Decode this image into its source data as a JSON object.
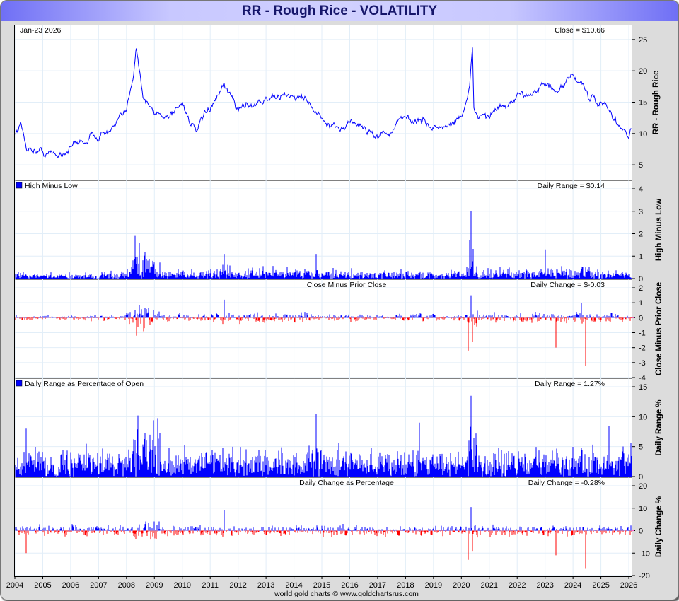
{
  "title": "RR  -  Rough Rice - VOLATILITY",
  "footer": "world gold charts © www.goldchartsrus.com",
  "colors": {
    "up": "#0000ff",
    "down": "#ff0000",
    "grid": "#e2eef8",
    "zero": "#ff66cc"
  },
  "chart_data": [
    {
      "type": "line",
      "title": "Rough Rice",
      "date_label": "Jan-23  2026",
      "value_label": "Close = $10.66",
      "ylabel": "RR  -  Rough Rice",
      "ylim": [
        4,
        26
      ],
      "yticks": [
        5,
        10,
        15,
        20,
        25
      ],
      "x": [
        2004.0,
        2004.2,
        2004.4,
        2005.0,
        2005.5,
        2006.0,
        2007.0,
        2007.5,
        2008.0,
        2008.25,
        2008.35,
        2008.6,
        2009.0,
        2009.5,
        2010.0,
        2010.5,
        2011.0,
        2011.5,
        2012.0,
        2012.5,
        2013.0,
        2014.0,
        2014.5,
        2015.0,
        2015.5,
        2016.0,
        2016.5,
        2017.0,
        2017.5,
        2018.0,
        2018.5,
        2019.0,
        2019.5,
        2020.0,
        2020.3,
        2020.4,
        2020.45,
        2021.0,
        2021.5,
        2022.0,
        2022.5,
        2023.0,
        2023.5,
        2024.0,
        2024.4,
        2024.6,
        2025.0,
        2025.5,
        2026.0,
        2026.06
      ],
      "y": [
        10,
        11.5,
        8,
        7,
        6.5,
        8,
        10,
        10.5,
        13,
        20,
        24.5,
        16,
        13,
        13,
        15,
        10,
        14,
        17,
        14,
        15,
        15.5,
        16,
        15.5,
        12,
        10,
        12,
        11,
        9.8,
        10.5,
        12.5,
        12,
        11,
        11,
        13,
        17,
        23,
        13,
        13,
        14,
        15,
        17,
        18,
        16,
        19,
        18,
        15,
        15,
        12,
        9.5,
        10.66
      ]
    },
    {
      "type": "bar",
      "title": "High Minus Low",
      "value_label": "Daily Range = $0.14",
      "ylabel": "High Minus Low",
      "ylim": [
        0,
        4
      ],
      "yticks": [
        0,
        1,
        2,
        3,
        4
      ],
      "spikes": [
        [
          2008.3,
          1.9
        ],
        [
          2008.45,
          1.6
        ],
        [
          2020.35,
          3.0
        ],
        [
          2020.3,
          1.7
        ],
        [
          2023.0,
          1.3
        ],
        [
          2011.5,
          1.1
        ],
        [
          2014.8,
          1.1
        ]
      ]
    },
    {
      "type": "bar",
      "title": "Close Minus Prior Close",
      "value_label": "Daily Change = $-0.03",
      "ylabel": "Close Minus Prior Close",
      "ylim": [
        -4,
        2
      ],
      "yticks": [
        -4,
        -3,
        -2,
        -1,
        0,
        1,
        2
      ],
      "spikes": [
        [
          2020.35,
          1.5
        ],
        [
          2020.25,
          -2.2
        ],
        [
          2020.4,
          -1.6
        ],
        [
          2023.4,
          -2.0
        ],
        [
          2024.45,
          -3.2
        ],
        [
          2008.35,
          -1.2
        ],
        [
          2011.5,
          1.2
        ],
        [
          2024.3,
          1.0
        ]
      ]
    },
    {
      "type": "bar",
      "title": "Daily Range as Percentage of Open",
      "value_label": "Daily Range = 1.27%",
      "ylabel": "Daily Range %",
      "ylim": [
        0,
        15
      ],
      "yticks": [
        0,
        5,
        10,
        15
      ],
      "spikes": [
        [
          2020.35,
          13.5
        ],
        [
          2008.4,
          10.2
        ],
        [
          2014.8,
          10.5
        ],
        [
          2018.5,
          9
        ],
        [
          2004.4,
          8
        ],
        [
          2025.3,
          8.5
        ]
      ]
    },
    {
      "type": "bar",
      "title": "Daily Change as Percentage",
      "value_label": "Daily Change = -0.28%",
      "ylabel": "Daily Change %",
      "ylim": [
        -20,
        20
      ],
      "yticks": [
        -20,
        -10,
        0,
        10,
        20
      ],
      "spikes": [
        [
          2020.35,
          10.5
        ],
        [
          2020.25,
          -13
        ],
        [
          2020.4,
          -9
        ],
        [
          2023.4,
          -11
        ],
        [
          2024.45,
          -17
        ],
        [
          2004.4,
          -10
        ],
        [
          2011.5,
          9
        ]
      ]
    }
  ],
  "xaxis": {
    "xlim": [
      2004,
      2026.1
    ],
    "ticks": [
      "2004",
      "2005",
      "2006",
      "2007",
      "2008",
      "2009",
      "2010",
      "2011",
      "2012",
      "2013",
      "2014",
      "2015",
      "2016",
      "2017",
      "2018",
      "2019",
      "2020",
      "2021",
      "2022",
      "2023",
      "2024",
      "2025",
      "2026"
    ]
  }
}
